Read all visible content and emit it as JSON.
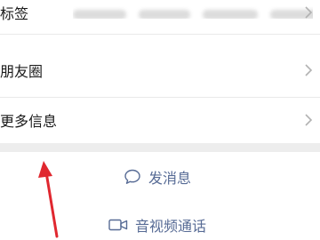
{
  "rows": {
    "tags": {
      "label": "标签"
    },
    "moments": {
      "label": "朋友圈"
    },
    "more_info": {
      "label": "更多信息"
    }
  },
  "actions": {
    "send_message": {
      "label": "发消息",
      "icon": "chat-bubble-icon"
    },
    "video_call": {
      "label": "音视频通话",
      "icon": "video-camera-icon"
    }
  },
  "colors": {
    "accent": "#576b95",
    "arrow": "#e0272f",
    "separator": "#ededed",
    "text": "#1a1a1a",
    "chevron": "#b2b2b2"
  }
}
